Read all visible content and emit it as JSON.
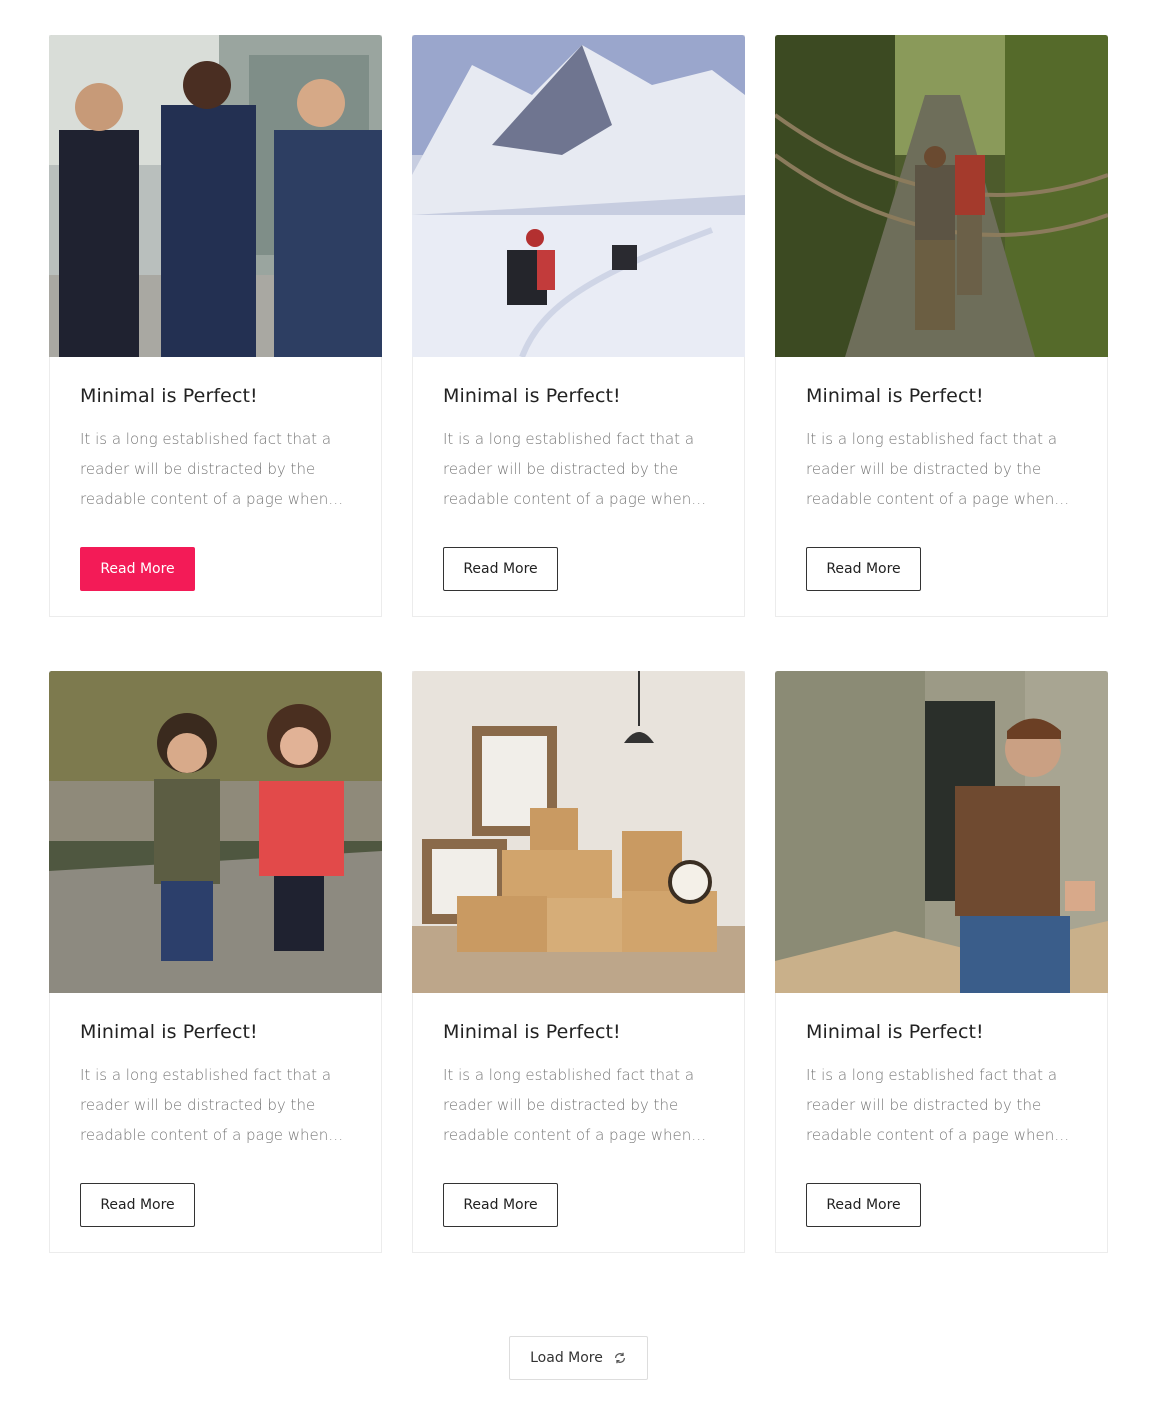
{
  "cards": [
    {
      "title": "Minimal is Perfect!",
      "excerpt": [
        "It is a long established fact that a",
        "reader will be distracted by the",
        "readable content of a page when…"
      ],
      "button": "Read More",
      "image": "business-men-walking"
    },
    {
      "title": "Minimal is Perfect!",
      "excerpt": [
        "It is a long established fact that a",
        "reader will be distracted by the",
        "readable content of a page when…"
      ],
      "button": "Read More",
      "image": "snowy-mountain-hikers"
    },
    {
      "title": "Minimal is Perfect!",
      "excerpt": [
        "It is a long established fact that a",
        "reader will be distracted by the",
        "readable content of a page when…"
      ],
      "button": "Read More",
      "image": "rope-bridge-forest"
    },
    {
      "title": "Minimal is Perfect!",
      "excerpt": [
        "It is a long established fact that a",
        "reader will be distracted by the",
        "readable content of a page when…"
      ],
      "button": "Read More",
      "image": "two-children-walkway"
    },
    {
      "title": "Minimal is Perfect!",
      "excerpt": [
        "It is a long established fact that a",
        "reader will be distracted by the",
        "readable content of a page when…"
      ],
      "button": "Read More",
      "image": "moving-boxes-room"
    },
    {
      "title": "Minimal is Perfect!",
      "excerpt": [
        "It is a long established fact that a",
        "reader will be distracted by the",
        "readable content of a page when…"
      ],
      "button": "Read More",
      "image": "backpacker-cliffs"
    }
  ],
  "load_more": {
    "label": "Load More",
    "icon": "refresh-icon"
  },
  "colors": {
    "accent": "#f31b57",
    "border": "#ececec",
    "text": "#222222",
    "muted": "#777777"
  }
}
